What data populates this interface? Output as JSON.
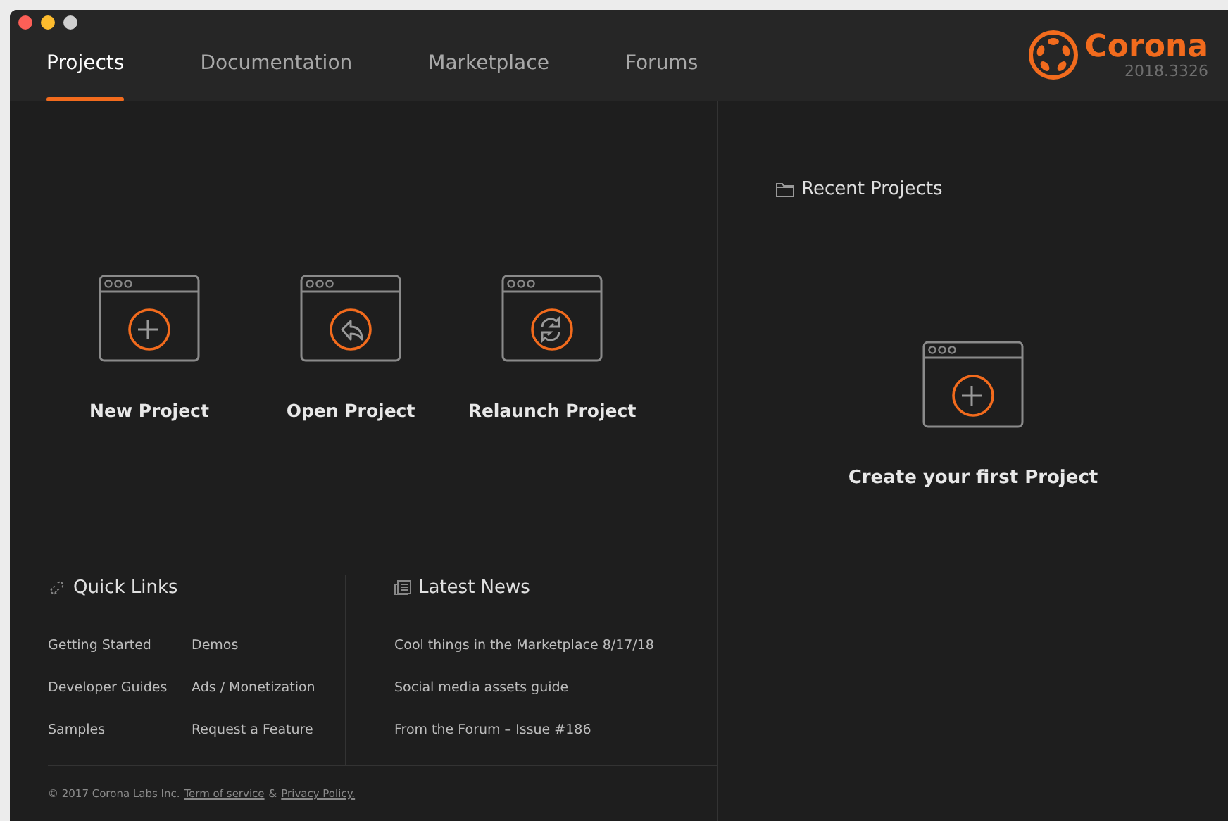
{
  "tabs": [
    {
      "label": "Projects",
      "selected": true
    },
    {
      "label": "Documentation",
      "selected": false
    },
    {
      "label": "Marketplace",
      "selected": false
    },
    {
      "label": "Forums",
      "selected": false
    }
  ],
  "brand": {
    "name": "Corona",
    "version": "2018.3326"
  },
  "actions": [
    {
      "kind": "new",
      "label": "New Project"
    },
    {
      "kind": "open",
      "label": "Open Project"
    },
    {
      "kind": "relaunch",
      "label": "Relaunch Project"
    }
  ],
  "quick_links": {
    "title": "Quick Links",
    "items": [
      "Getting Started",
      "Demos",
      "Developer Guides",
      "Ads / Monetization",
      "Samples",
      "Request a Feature"
    ]
  },
  "latest_news": {
    "title": "Latest News",
    "items": [
      "Cool things in the Marketplace 8/17/18",
      "Social media assets guide",
      "From the Forum – Issue #186"
    ]
  },
  "footer": {
    "copyright": "© 2017 Corona Labs Inc.",
    "terms": "Term of service",
    "and": "&",
    "privacy": "Privacy Policy."
  },
  "recent": {
    "title": "Recent Projects",
    "empty_label": "Create your first Project"
  }
}
